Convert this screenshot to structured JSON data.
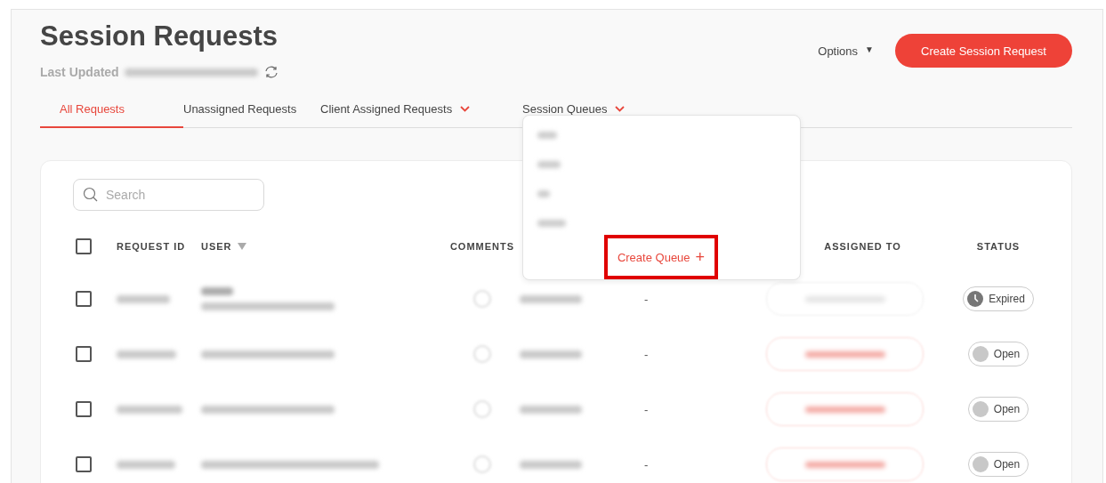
{
  "header": {
    "title": "Session Requests",
    "last_updated_label": "Last Updated",
    "options": {
      "label": "Options",
      "caret": "▼"
    },
    "primary_button": "Create Session Request"
  },
  "tabs": [
    {
      "label": "All Requests",
      "selected": true,
      "has_menu": false
    },
    {
      "label": "Unassigned Requests",
      "selected": false,
      "has_menu": false
    },
    {
      "label": "Client Assigned Requests",
      "selected": false,
      "has_menu": true
    },
    {
      "label": "Session Queues",
      "selected": false,
      "has_menu": true
    }
  ],
  "queue_menu": {
    "create_button": "Create Queue",
    "plus": "+"
  },
  "search": {
    "placeholder": "Search"
  },
  "table": {
    "select_all": {
      "checked": false
    },
    "columns": [
      {
        "label": "REQUEST ID",
        "sortable": false
      },
      {
        "label": "USER",
        "sortable": true
      },
      {
        "label": "COMMENTS",
        "sortable": false
      },
      {
        "label": "ASSIGNED TO",
        "sortable": false
      },
      {
        "label": "STATUS",
        "sortable": false
      }
    ],
    "rows": [
      {
        "checked": false,
        "named_user": true,
        "assigned": "-",
        "assign_enabled": false,
        "status": {
          "kind": "expired",
          "label": "Expired"
        }
      },
      {
        "checked": false,
        "named_user": false,
        "assigned": "-",
        "assign_enabled": true,
        "status": {
          "kind": "open",
          "label": "Open"
        }
      },
      {
        "checked": false,
        "named_user": false,
        "assigned": "-",
        "assign_enabled": true,
        "status": {
          "kind": "open",
          "label": "Open"
        }
      },
      {
        "checked": false,
        "named_user": false,
        "assigned": "-",
        "assign_enabled": true,
        "status": {
          "kind": "open",
          "label": "Open"
        }
      }
    ]
  }
}
